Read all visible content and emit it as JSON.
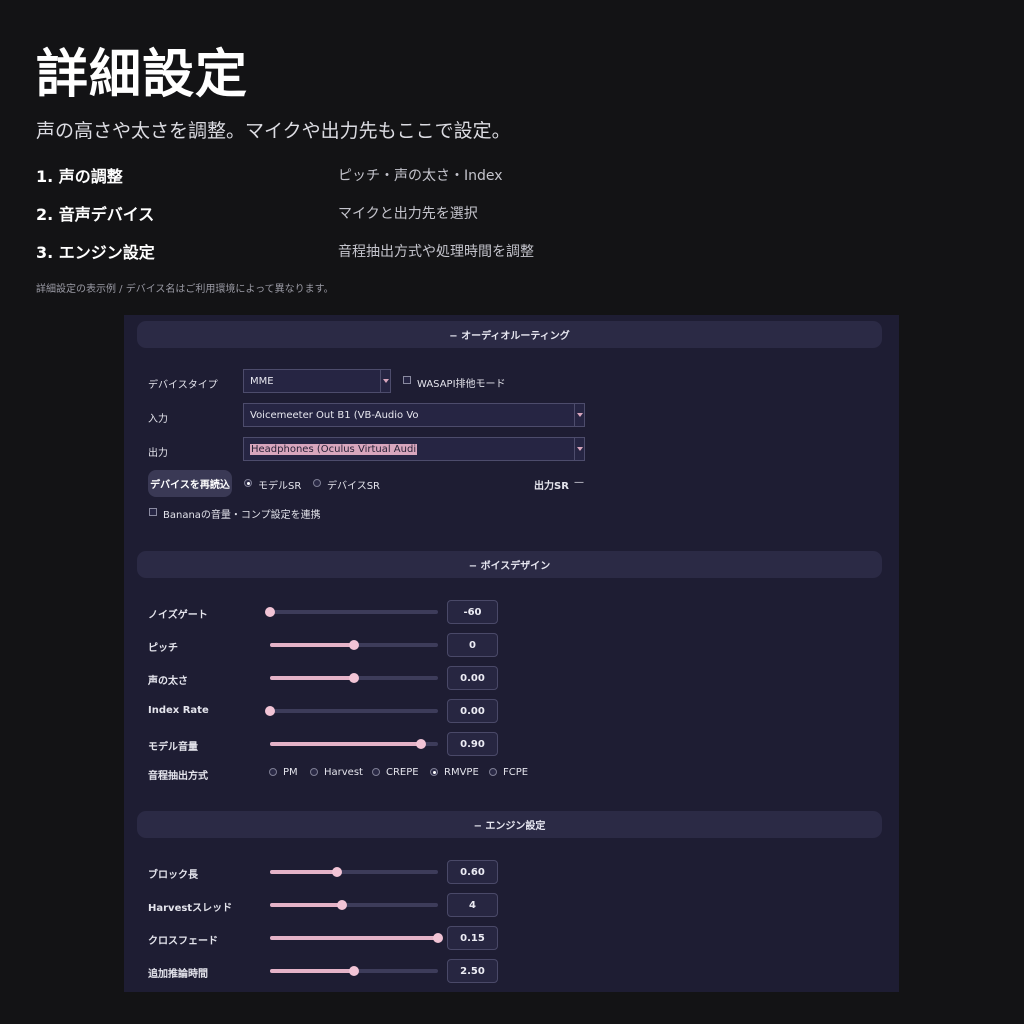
{
  "header": {
    "title": "詳細設定",
    "subtitle": "声の高さや太さを調整。マイクや出力先もここで設定。",
    "steps": [
      {
        "label": "1. 声の調整",
        "desc": "ピッチ・声の太さ・Index"
      },
      {
        "label": "2. 音声デバイス",
        "desc": "マイクと出力先を選択"
      },
      {
        "label": "3. エンジン設定",
        "desc": "音程抽出方式や処理時間を調整"
      }
    ],
    "note": "詳細設定の表示例 / デバイス名はご利用環境によって異なります。"
  },
  "audio": {
    "section_title": "− オーディオルーティング",
    "device_type_label": "デバイスタイプ",
    "device_type_value": "MME",
    "wasapi_label": "WASAPI排他モード",
    "wasapi_checked": false,
    "input_label": "入力",
    "input_value": "Voicemeeter Out B1 (VB-Audio Vo",
    "output_label": "出力",
    "output_value": "Headphones (Oculus Virtual Audi",
    "reload_button": "デバイスを再読込",
    "sr_options": [
      "モデルSR",
      "デバイスSR"
    ],
    "sr_selected": "モデルSR",
    "output_sr_label": "出力SR",
    "output_sr_value": "—",
    "banana_label": "Bananaの音量・コンプ設定を連携",
    "banana_checked": false
  },
  "voice": {
    "section_title": "− ボイスデザイン",
    "sliders": [
      {
        "label": "ノイズゲート",
        "value": "-60",
        "fraction": 0.0
      },
      {
        "label": "ピッチ",
        "value": "0",
        "fraction": 0.5
      },
      {
        "label": "声の太さ",
        "value": "0.00",
        "fraction": 0.5
      },
      {
        "label": "Index Rate",
        "value": "0.00",
        "fraction": 0.0
      },
      {
        "label": "モデル音量",
        "value": "0.90",
        "fraction": 0.9
      }
    ],
    "pitch_method_label": "音程抽出方式",
    "pitch_methods": [
      "PM",
      "Harvest",
      "CREPE",
      "RMVPE",
      "FCPE"
    ],
    "pitch_method_selected": "RMVPE"
  },
  "engine": {
    "section_title": "− エンジン設定",
    "sliders": [
      {
        "label": "ブロック長",
        "value": "0.60",
        "fraction": 0.4
      },
      {
        "label": "Harvestスレッド",
        "value": "4",
        "fraction": 0.43
      },
      {
        "label": "クロスフェード",
        "value": "0.15",
        "fraction": 1.0
      },
      {
        "label": "追加推論時間",
        "value": "2.50",
        "fraction": 0.5
      }
    ]
  },
  "colors": {
    "background": "#131315",
    "panel": "#1e1d33",
    "accent": "#e5b3c8"
  }
}
